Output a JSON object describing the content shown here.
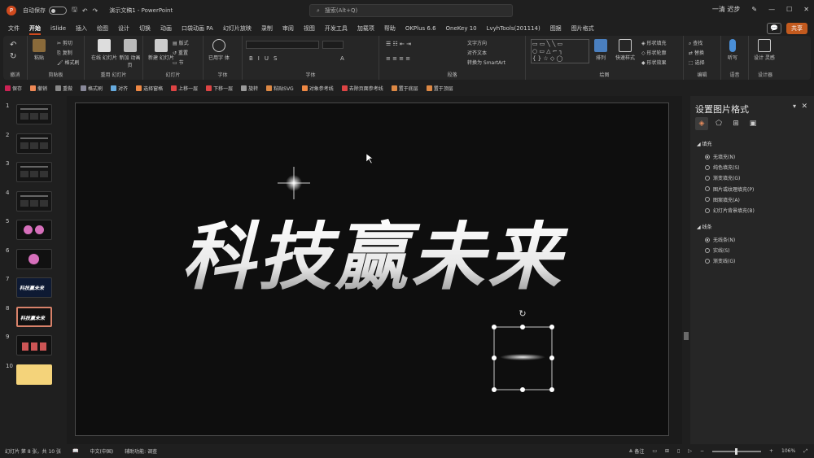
{
  "titlebar": {
    "autosave": "自动保存",
    "autosave_state": "关",
    "title": "演示文稿1  -  PowerPoint",
    "search_placeholder": "搜索(Alt+Q)",
    "user": "一清 迟步"
  },
  "tabs": [
    "文件",
    "开始",
    "iSlide",
    "插入",
    "绘图",
    "设计",
    "切换",
    "动画",
    "口袋动画 PA",
    "幻灯片放映",
    "录制",
    "审阅",
    "视图",
    "开发工具",
    "加载项",
    "帮助",
    "OKPlus 6.6",
    "OneKey 10",
    "LvyhTools(201114)",
    "图据",
    "图片格式"
  ],
  "active_tab": "开始",
  "share_label": "共享",
  "ribbon": {
    "groups": [
      "撤消",
      "剪贴板",
      "幻灯片",
      "字体",
      "段落",
      "绘图",
      "编辑",
      "语音",
      "设计器"
    ],
    "paste": "粘贴",
    "cut": "剪切",
    "copy": "复制",
    "format_painter": "格式刷",
    "reuse_slides": "重用\n幻灯片",
    "new_slide_a": "在线\n幻灯片",
    "new_slide_b": "新加\n动画页",
    "new_slide": "新建\n幻灯片",
    "layout": "版式",
    "reset": "重置",
    "section": "节",
    "font_group_btn": "已用字\n体",
    "text_direction": "文字方向",
    "align_text": "对齐文本",
    "smartart": "转换为 SmartArt",
    "arrange": "排列",
    "quick_styles": "快速样式",
    "shape_fill": "形状填充",
    "shape_outline": "形状轮廓",
    "shape_effects": "形状效果",
    "find": "查找",
    "replace": "替换",
    "select": "选择",
    "dictate": "听写",
    "designer": "设计\n灵感"
  },
  "qat": [
    "保存",
    "撤销",
    "重做",
    "格式刷",
    "对齐",
    "选择窗格",
    "上移一层",
    "下移一层",
    "旋转",
    "粘贴SVG",
    "对象参考线",
    "去除页面参考线",
    "置于底层",
    "置于顶层"
  ],
  "thumbnails": [
    {
      "num": "1"
    },
    {
      "num": "2"
    },
    {
      "num": "3"
    },
    {
      "num": "4"
    },
    {
      "num": "5"
    },
    {
      "num": "6"
    },
    {
      "num": "7",
      "text": "科技赢未来"
    },
    {
      "num": "8",
      "text": "科技赢未来"
    },
    {
      "num": "9"
    },
    {
      "num": "10"
    }
  ],
  "slide": {
    "headline": "科技赢未来"
  },
  "panel": {
    "title": "设置图片格式",
    "fill_section": "填充",
    "fill_options": [
      "无填充(N)",
      "纯色填充(S)",
      "渐变填充(G)",
      "图片或纹理填充(P)",
      "图案填充(A)",
      "幻灯片背景填充(B)"
    ],
    "line_section": "线条",
    "line_options": [
      "无线条(N)",
      "实线(S)",
      "渐变线(G)"
    ]
  },
  "status": {
    "slide_info": "幻灯片 第 8 张，共 10 张",
    "language": "中文(中国)",
    "accessibility": "辅助功能: 调查",
    "notes": "备注",
    "zoom": "106%"
  },
  "colors": {
    "accent": "#d04a1e",
    "selected_thumb": "#d8826a",
    "thumb10": "#f4d37a"
  }
}
